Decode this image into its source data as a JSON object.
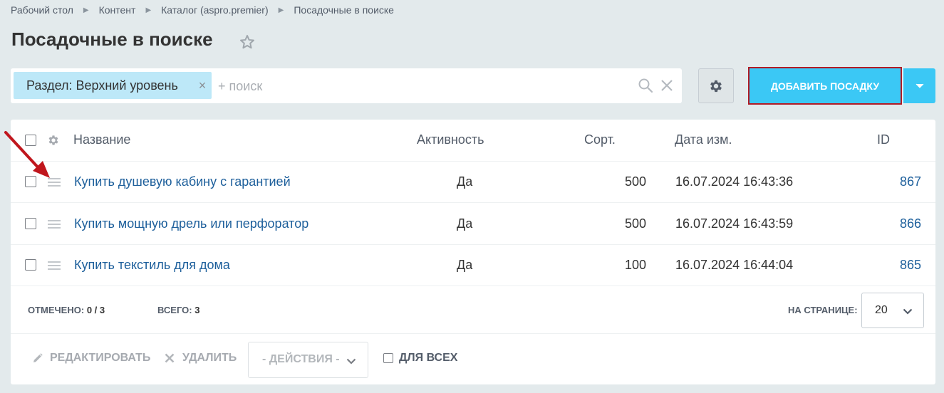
{
  "breadcrumbs": [
    "Рабочий стол",
    "Контент",
    "Каталог (aspro.premier)",
    "Посадочные в поиске"
  ],
  "page": {
    "title": "Посадочные в поиске"
  },
  "filter": {
    "chip_label": "Раздел: Верхний уровень",
    "placeholder": "+ поиск",
    "value": ""
  },
  "toolbar": {
    "add_label": "ДОБАВИТЬ ПОСАДКУ"
  },
  "colors": {
    "accent": "#3bc8f5",
    "highlight_border": "#b11b25",
    "link": "#1d5f9b",
    "chip_bg": "#bde8f8",
    "annotation_arrow": "#c0161d"
  },
  "icons": {
    "star": "star-icon",
    "search": "search-icon",
    "clear": "close-icon",
    "settings": "gear-icon",
    "drag": "drag-handle-icon",
    "dropdown": "chevron-down-icon",
    "edit": "pencil-icon",
    "delete": "close-icon"
  },
  "table": {
    "columns": [
      "Название",
      "Активность",
      "Сорт.",
      "Дата изм.",
      "ID"
    ],
    "rows": [
      {
        "name": "Купить душевую кабину с гарантией",
        "active": "Да",
        "sort": "500",
        "date": "16.07.2024 16:43:36",
        "id": "867"
      },
      {
        "name": "Купить мощную дрель или перфоратор",
        "active": "Да",
        "sort": "500",
        "date": "16.07.2024 16:43:59",
        "id": "866"
      },
      {
        "name": "Купить текстиль для дома",
        "active": "Да",
        "sort": "100",
        "date": "16.07.2024 16:44:04",
        "id": "865"
      }
    ]
  },
  "footer": {
    "selected_label": "ОТМЕЧЕНО:",
    "selected_value": "0 / 3",
    "total_label": "ВСЕГО:",
    "total_value": "3",
    "per_page_label": "НА СТРАНИЦЕ:",
    "per_page_value": "20"
  },
  "actions": {
    "edit_label": "РЕДАКТИРОВАТЬ",
    "delete_label": "УДАЛИТЬ",
    "select_label": "- ДЕЙСТВИЯ -",
    "for_all_label": "ДЛЯ ВСЕХ"
  }
}
